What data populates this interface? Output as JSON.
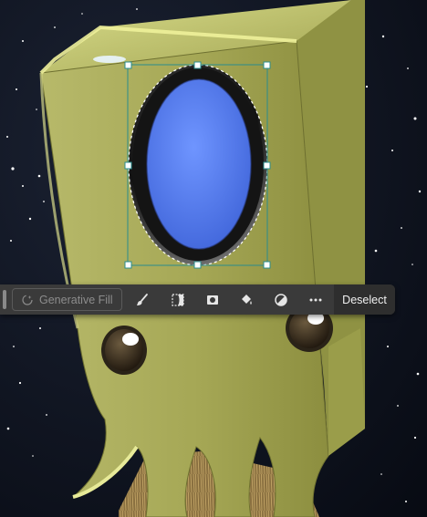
{
  "toolbar": {
    "generative_fill_label": "Generative Fill",
    "deselect_label": "Deselect",
    "tools": [
      {
        "name": "brush-icon"
      },
      {
        "name": "select-subject-icon"
      },
      {
        "name": "mask-icon"
      },
      {
        "name": "fill-bucket-icon"
      },
      {
        "name": "adjustment-icon"
      },
      {
        "name": "more-icon"
      }
    ]
  },
  "colors": {
    "toolbar_bg": "#3a3a3a",
    "character_body": "#a9ab5a",
    "eye_blue": "#4d78f0",
    "selection_line": "#2a8c8c"
  }
}
